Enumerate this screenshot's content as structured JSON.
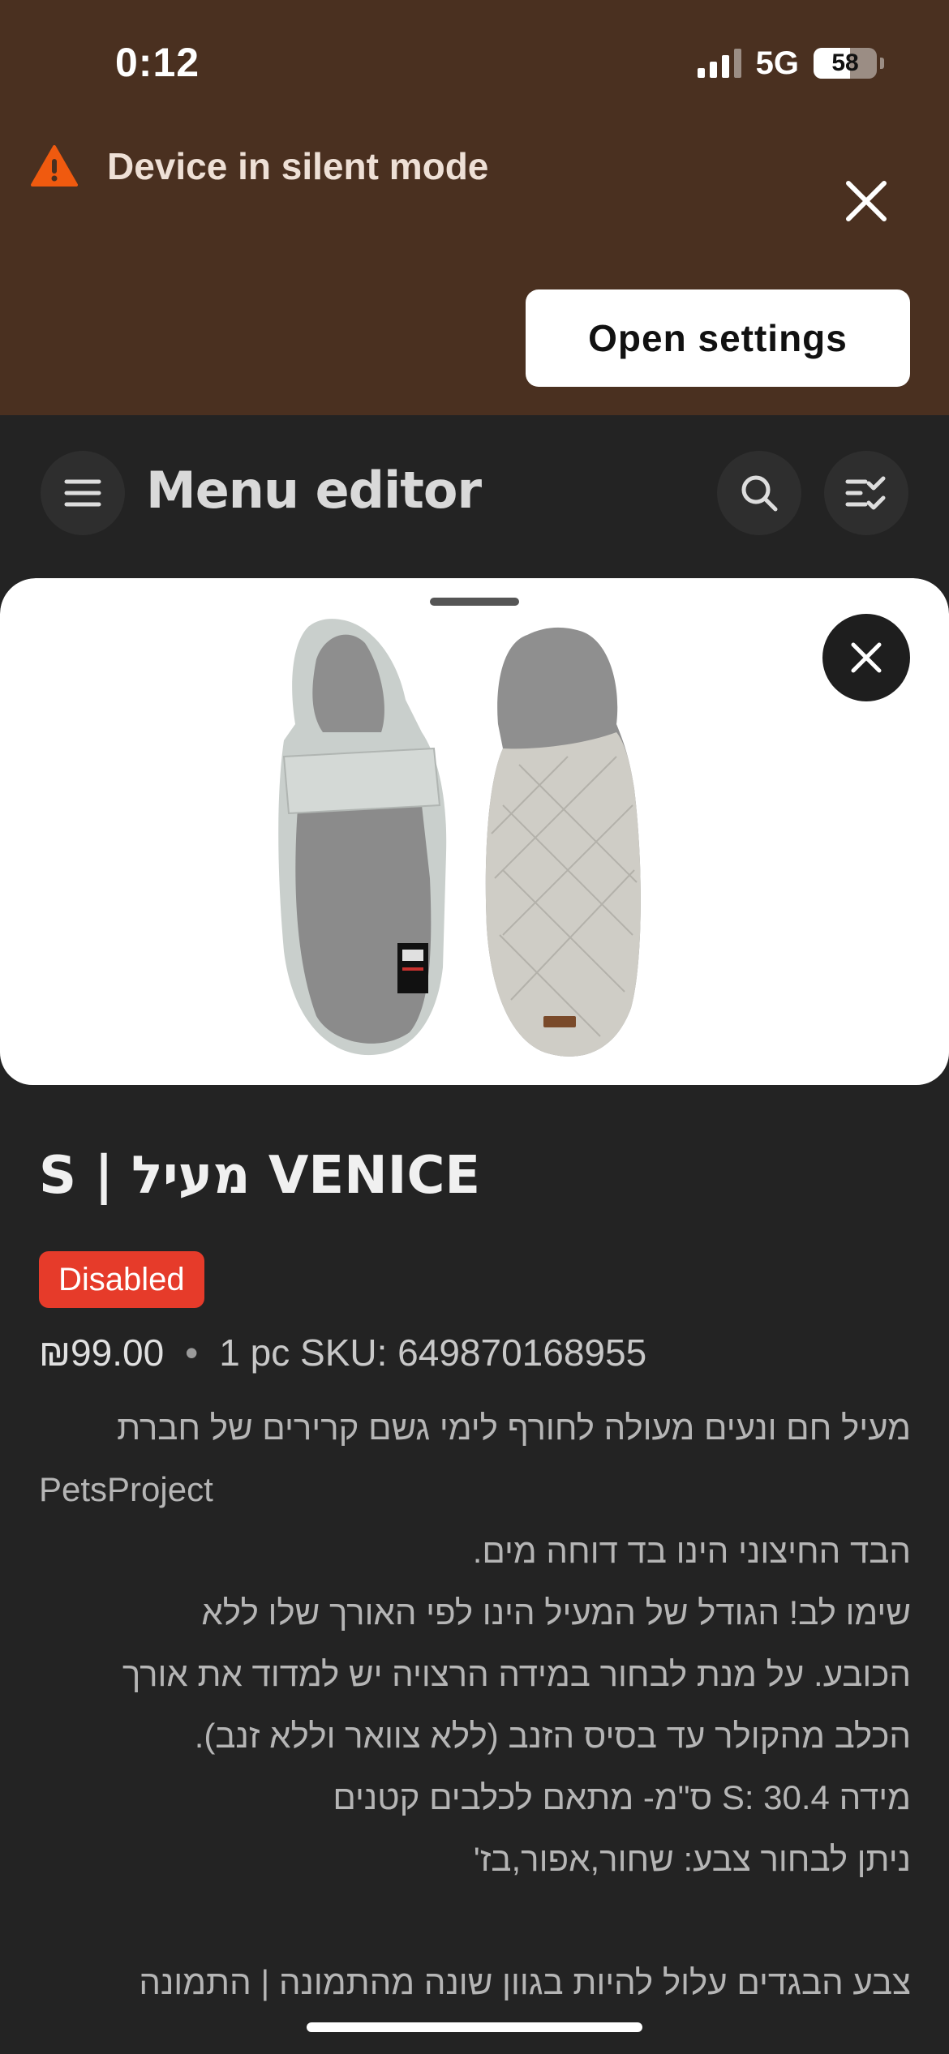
{
  "status_bar": {
    "time": "0:12",
    "network": "5G",
    "battery": "58",
    "battery_level": 0.58
  },
  "banner": {
    "message": "Device in silent mode",
    "button_label": "Open settings",
    "warning_color": "#f05a0f"
  },
  "appbar": {
    "title": "Menu editor"
  },
  "item": {
    "title": "S | מעיל VENICE",
    "status_badge": "Disabled",
    "price": "₪99.00",
    "unit_sku": "1 pc SKU: 649870168955",
    "description_lines": [
      "מעיל חם ונעים מעולה לחורף לימי גשם קרירים  של חברת",
      "PetsProject",
      "הבד החיצוני הינו בד דוחה מים.",
      "שימו לב! הגודל של המעיל הינו לפי האורך שלו ללא",
      "הכובע. על מנת לבחור במידה הרצויה יש למדוד את אורך",
      "הכלב מהקולר עד בסיס הזנב (ללא צוואר וללא זנב).",
      "מידה S: 30.4 ס\"מ- מתאם לכלבים קטנים",
      "ניתן לבחור צבע: שחור,אפור,בז'",
      "",
      "צבע הבגדים עלול להיות בגוון שונה מהתמונה | התמונה"
    ]
  },
  "colors": {
    "accent": "#e63b2a",
    "banner_bg": "#4a3020",
    "background": "#232323"
  }
}
